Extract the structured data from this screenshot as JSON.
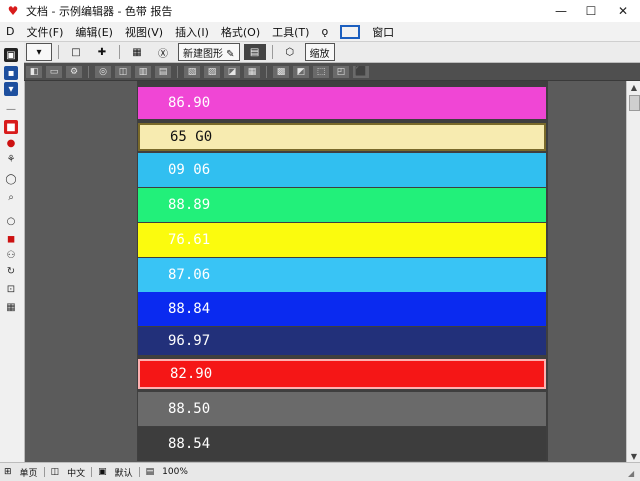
{
  "window": {
    "title": "文档 - 示例编辑器 - 色带 报告",
    "minimize": "—",
    "maximize": "☐",
    "close": "✕",
    "accent": "#d81b1b"
  },
  "menu": {
    "items": [
      "D",
      "文件(F)",
      "编辑(E)",
      "视图(V)",
      "插入(I)",
      "格式(O)",
      "工具(T)",
      "ǫ",
      "窗口"
    ]
  },
  "toolbar": {
    "buttons": [
      "▾",
      "□",
      "✚",
      "▦",
      "Ⓧ",
      "新建图形 ✎",
      "▤",
      "⬡",
      "缩放"
    ]
  },
  "toolbar2": {
    "buttons": [
      "◧",
      "▭",
      "⚙",
      "◎",
      "◫",
      "▥",
      "▤",
      "▧",
      "▨",
      "◪",
      "▦",
      "▩",
      "◩",
      "⬚",
      "◰",
      "⬛"
    ]
  },
  "strips": [
    {
      "label": "86.90",
      "bg": "#f046d5",
      "fg": "#ffffff"
    },
    {
      "label": "65 G0",
      "bg": "#f7ebb0",
      "fg": "#111111"
    },
    {
      "label": "09 06",
      "bg": "#31bff0",
      "fg": "#ffffff"
    },
    {
      "label": "88.89",
      "bg": "#22f07a",
      "fg": "#ffffff"
    },
    {
      "label": "76.61",
      "bg": "#fbfb0e",
      "fg": "#ffffff"
    },
    {
      "label": "87.06",
      "bg": "#39c4f5",
      "fg": "#ffffff"
    },
    {
      "label": "88.84",
      "bg": "#0a2af0",
      "fg": "#ffffff"
    },
    {
      "label": "96.97",
      "bg": "#22307a",
      "fg": "#ffffff"
    },
    {
      "label": "82.90",
      "bg": "#f51616",
      "fg": "#ffffff"
    },
    {
      "label": "88.50",
      "bg": "#6a6a6a",
      "fg": "#ffffff"
    },
    {
      "label": "88.54",
      "bg": "#3d3d3d",
      "fg": "#ffffff"
    }
  ],
  "status": {
    "items": [
      "⊞",
      "单页",
      "◫",
      "中文",
      "▣",
      "默认",
      "▤",
      "100%"
    ]
  }
}
